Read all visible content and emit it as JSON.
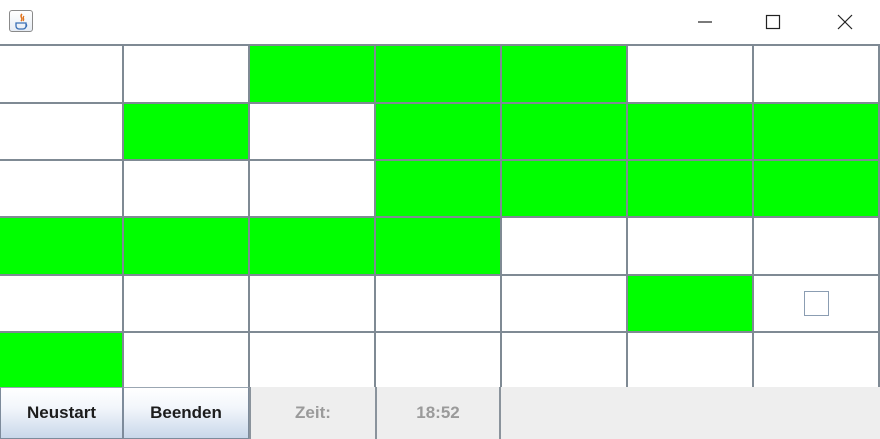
{
  "window": {
    "icon": "java-app-icon",
    "controls": [
      "minimize-icon",
      "maximize-icon",
      "close-icon"
    ]
  },
  "board": {
    "rows": 6,
    "cols": 7,
    "on_color": "#00ff00",
    "off_color": "#ffffff",
    "line_color": "#7f8a94",
    "cells": [
      [
        0,
        0,
        1,
        1,
        1,
        0,
        0
      ],
      [
        0,
        1,
        0,
        1,
        1,
        1,
        1
      ],
      [
        0,
        0,
        0,
        1,
        1,
        1,
        1
      ],
      [
        1,
        1,
        1,
        1,
        0,
        0,
        0
      ],
      [
        0,
        0,
        0,
        0,
        0,
        1,
        0
      ],
      [
        1,
        0,
        0,
        0,
        0,
        0,
        0
      ]
    ],
    "checkbox_cell": {
      "row": 4,
      "col": 6,
      "checked": false
    }
  },
  "footer": {
    "restart_label": "Neustart",
    "quit_label": "Beenden",
    "time_label": "Zeit:",
    "time_value": "18:52"
  }
}
